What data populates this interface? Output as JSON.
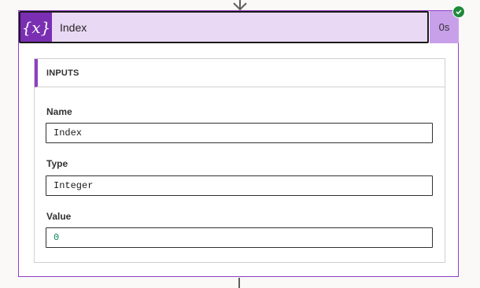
{
  "action": {
    "title": "Index",
    "icon": "variable-icon",
    "icon_glyph": "{x}",
    "duration": "0s",
    "status": "succeeded"
  },
  "inputs": {
    "header": "INPUTS",
    "fields": [
      {
        "label": "Name",
        "value": "Index"
      },
      {
        "label": "Type",
        "value": "Integer"
      },
      {
        "label": "Value",
        "value": "0"
      }
    ]
  },
  "colors": {
    "accent": "#8e3fc6",
    "header_bg": "#e9d9f4",
    "icon_bg": "#7a2fb3",
    "duration_bg": "#c8a0ea",
    "success": "#1f8a3b"
  }
}
